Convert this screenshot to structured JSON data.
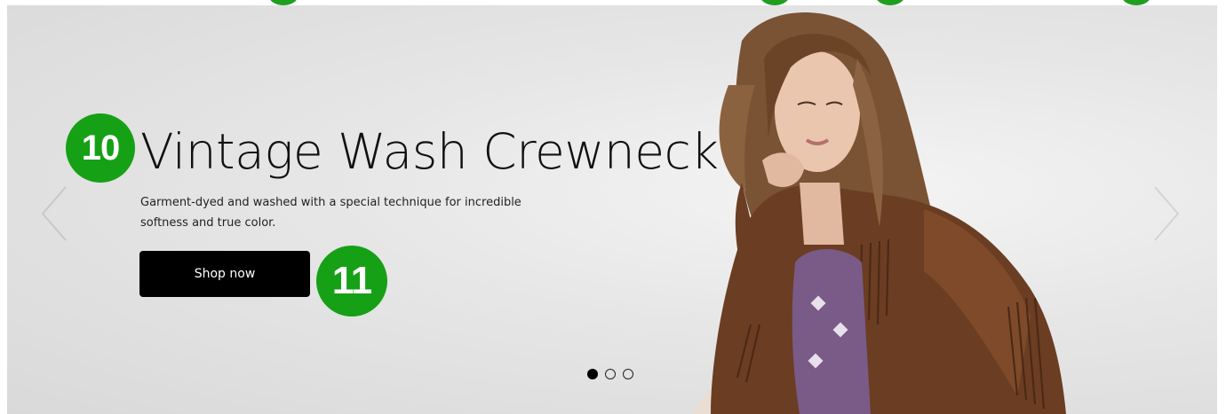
{
  "slide": {
    "title": "Vintage Wash Crewneck",
    "description": "Garment-dyed and washed with a special technique for incredible softness and true color.",
    "cta_label": "Shop now"
  },
  "annotations": {
    "title_marker": "10",
    "cta_marker": "11"
  },
  "carousel": {
    "slide_count": 3,
    "active_index": 0
  },
  "colors": {
    "marker_green": "#16a016",
    "button_bg": "#000000",
    "button_text": "#ffffff",
    "title_text": "#111111"
  },
  "icons": {
    "prev": "chevron-left-icon",
    "next": "chevron-right-icon"
  }
}
